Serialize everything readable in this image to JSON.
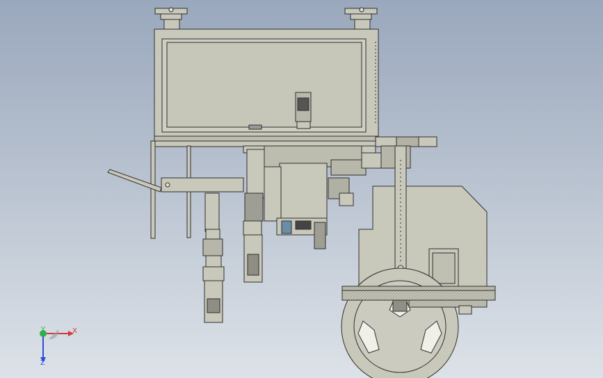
{
  "model_view": {
    "description_free": true,
    "background": {
      "top": "#9aa8bd",
      "bottom": "#dde2e8"
    },
    "part_fill": "#c8c8bb",
    "part_stroke": "#2f2f2f",
    "accent_blue": "#2d63b5"
  },
  "triad": {
    "x_label": "X",
    "y_label": "Y",
    "z_label": "Z",
    "x_color": "#d23a3a",
    "y_color": "#2db04a",
    "z_color": "#2a4fd6"
  }
}
